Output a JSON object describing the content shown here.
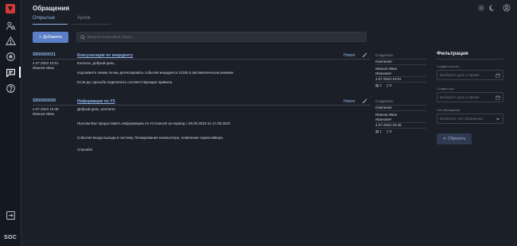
{
  "header": {
    "title": "Обращения"
  },
  "tabs": [
    {
      "label": "Открытые"
    },
    {
      "label": "Архив"
    }
  ],
  "toolbar": {
    "add_label": "Добавить",
    "search_placeholder": "Введите поисковый запрос..."
  },
  "sidebar": {
    "soc_label": "SOC"
  },
  "tickets": [
    {
      "id": "SR0000031",
      "subject": "Консультация по инциденту",
      "status": "Новое",
      "date": "4.07.2023 10:51",
      "author": "Иванов Иван",
      "message": [
        "Коллеги, добрый день,",
        "подскажите знаем ли мы детектировать события инцидента 12345 в автоматическом режиме.",
        "Если да, просьба подключить соответствующие правила."
      ],
      "creator_label": "Создатель:",
      "company": "Компания",
      "creator_name_1": "Иванов Иван",
      "creator_name_2": "Иванович",
      "created_at": "4.07.2023 10:51",
      "comments": "1",
      "attachments": "0"
    },
    {
      "id": "SR0000030",
      "subject": "Информация по УЗ",
      "status": "Новое",
      "date": "4.07.2023 10:48",
      "author": "Иванов Иван",
      "message": [
        "Добрый день, коллеги!",
        "Просим Вас предоставить информацию по УЗ ivanovii за период с 29.05.2023 по 17.06.2023",
        "События входа выхода в систему, блокирования компьютера, появление скринсэйвера.",
        "Спасибо!"
      ],
      "creator_label": "Создатель:",
      "company": "Компания",
      "creator_name_1": "Иванов Иван",
      "creator_name_2": "Иванович",
      "created_at": "4.07.2023 10:48",
      "comments": "1",
      "attachments": "0"
    }
  ],
  "filter": {
    "title": "Фильтрация",
    "created_from_label": "Создано после:",
    "created_from_placeholder": "Выберите дату и время",
    "created_to_label": "Создано до:",
    "created_to_placeholder": "Выберите дату и время",
    "type_label": "Тип обращения",
    "type_placeholder": "Выберите тип обращения",
    "reset_label": "Сбросить"
  },
  "colors": {
    "accent": "#8fb4e8",
    "button": "#5b7fc7",
    "logo": "#d63a3a",
    "background": "#1b1f27"
  }
}
